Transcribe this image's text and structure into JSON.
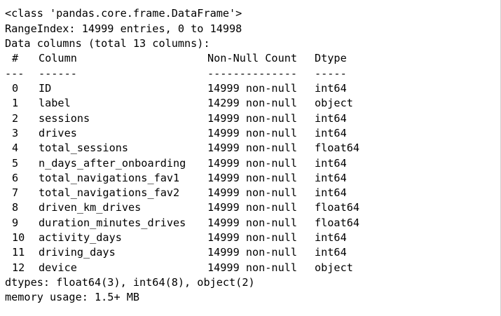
{
  "info": {
    "class_line": "<class 'pandas.core.frame.DataFrame'>",
    "range_index": "RangeIndex: 14999 entries, 0 to 14998",
    "data_columns": "Data columns (total 13 columns):",
    "header": {
      "hash": "#",
      "column": "Column",
      "count": "Non-Null Count",
      "dtype": "Dtype"
    },
    "separator": {
      "hash": "---",
      "column": "------",
      "count": "--------------",
      "dtype": "-----"
    },
    "rows": [
      {
        "idx": "0",
        "column": "ID",
        "count": "14999 non-null",
        "dtype": "int64"
      },
      {
        "idx": "1",
        "column": "label",
        "count": "14299 non-null",
        "dtype": "object"
      },
      {
        "idx": "2",
        "column": "sessions",
        "count": "14999 non-null",
        "dtype": "int64"
      },
      {
        "idx": "3",
        "column": "drives",
        "count": "14999 non-null",
        "dtype": "int64"
      },
      {
        "idx": "4",
        "column": "total_sessions",
        "count": "14999 non-null",
        "dtype": "float64"
      },
      {
        "idx": "5",
        "column": "n_days_after_onboarding",
        "count": "14999 non-null",
        "dtype": "int64"
      },
      {
        "idx": "6",
        "column": "total_navigations_fav1",
        "count": "14999 non-null",
        "dtype": "int64"
      },
      {
        "idx": "7",
        "column": "total_navigations_fav2",
        "count": "14999 non-null",
        "dtype": "int64"
      },
      {
        "idx": "8",
        "column": "driven_km_drives",
        "count": "14999 non-null",
        "dtype": "float64"
      },
      {
        "idx": "9",
        "column": "duration_minutes_drives",
        "count": "14999 non-null",
        "dtype": "float64"
      },
      {
        "idx": "10",
        "column": "activity_days",
        "count": "14999 non-null",
        "dtype": "int64"
      },
      {
        "idx": "11",
        "column": "driving_days",
        "count": "14999 non-null",
        "dtype": "int64"
      },
      {
        "idx": "12",
        "column": "device",
        "count": "14999 non-null",
        "dtype": "object"
      }
    ],
    "dtypes_line": "dtypes: float64(3), int64(8), object(2)",
    "memory_line": "memory usage: 1.5+ MB"
  }
}
